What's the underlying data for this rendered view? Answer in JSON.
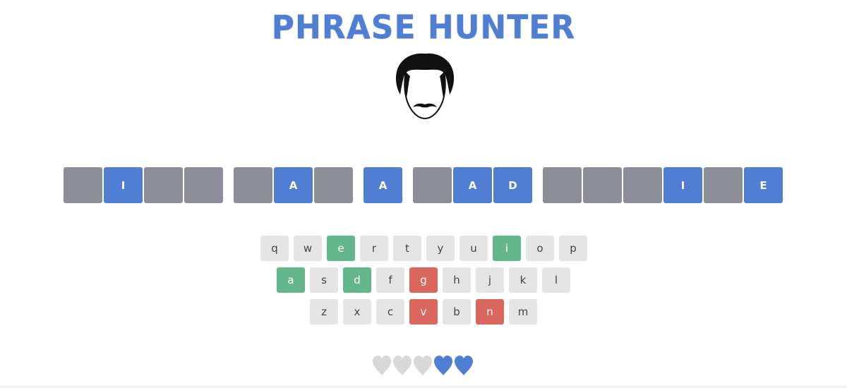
{
  "header": {
    "title": "PHRASE HUNTER",
    "title_color": "#4f7ed3"
  },
  "avatar": {
    "icon": "mustache-man-icon"
  },
  "phrase": {
    "tiles": [
      {
        "letter": "",
        "shown": false
      },
      {
        "letter": "I",
        "shown": true
      },
      {
        "letter": "",
        "shown": false
      },
      {
        "letter": "",
        "shown": false
      },
      {
        "letter": "",
        "space": true
      },
      {
        "letter": "",
        "shown": false
      },
      {
        "letter": "A",
        "shown": true
      },
      {
        "letter": "",
        "shown": false
      },
      {
        "letter": "",
        "space": true
      },
      {
        "letter": "A",
        "shown": true
      },
      {
        "letter": "",
        "space": true
      },
      {
        "letter": "",
        "shown": false
      },
      {
        "letter": "A",
        "shown": true
      },
      {
        "letter": "D",
        "shown": true
      },
      {
        "letter": "",
        "space": true
      },
      {
        "letter": "",
        "shown": false
      },
      {
        "letter": "",
        "shown": false
      },
      {
        "letter": "",
        "shown": false
      },
      {
        "letter": "I",
        "shown": true
      },
      {
        "letter": "",
        "shown": false
      },
      {
        "letter": "E",
        "shown": true
      }
    ],
    "hidden_color": "#8e8d9a",
    "shown_color": "#4f7ed3"
  },
  "keyboard": {
    "rows": [
      [
        {
          "key": "q",
          "state": "default"
        },
        {
          "key": "w",
          "state": "default"
        },
        {
          "key": "e",
          "state": "chosen"
        },
        {
          "key": "r",
          "state": "default"
        },
        {
          "key": "t",
          "state": "default"
        },
        {
          "key": "y",
          "state": "default"
        },
        {
          "key": "u",
          "state": "default"
        },
        {
          "key": "i",
          "state": "chosen"
        },
        {
          "key": "o",
          "state": "default"
        },
        {
          "key": "p",
          "state": "default"
        }
      ],
      [
        {
          "key": "a",
          "state": "chosen"
        },
        {
          "key": "s",
          "state": "default"
        },
        {
          "key": "d",
          "state": "chosen"
        },
        {
          "key": "f",
          "state": "default"
        },
        {
          "key": "g",
          "state": "wrong"
        },
        {
          "key": "h",
          "state": "default"
        },
        {
          "key": "j",
          "state": "default"
        },
        {
          "key": "k",
          "state": "default"
        },
        {
          "key": "l",
          "state": "default"
        }
      ],
      [
        {
          "key": "z",
          "state": "default"
        },
        {
          "key": "x",
          "state": "default"
        },
        {
          "key": "c",
          "state": "default"
        },
        {
          "key": "v",
          "state": "wrong"
        },
        {
          "key": "b",
          "state": "default"
        },
        {
          "key": "n",
          "state": "wrong"
        },
        {
          "key": "m",
          "state": "default"
        }
      ]
    ],
    "colors": {
      "default": "#e5e5e5",
      "chosen": "#63b78b",
      "wrong": "#d9675e"
    }
  },
  "lives": {
    "total": 5,
    "lost": 3,
    "hearts": [
      "lost",
      "lost",
      "lost",
      "live",
      "live"
    ],
    "live_color": "#4f7ed3",
    "lost_color": "#d8d8d8",
    "icon": "heart-icon"
  }
}
